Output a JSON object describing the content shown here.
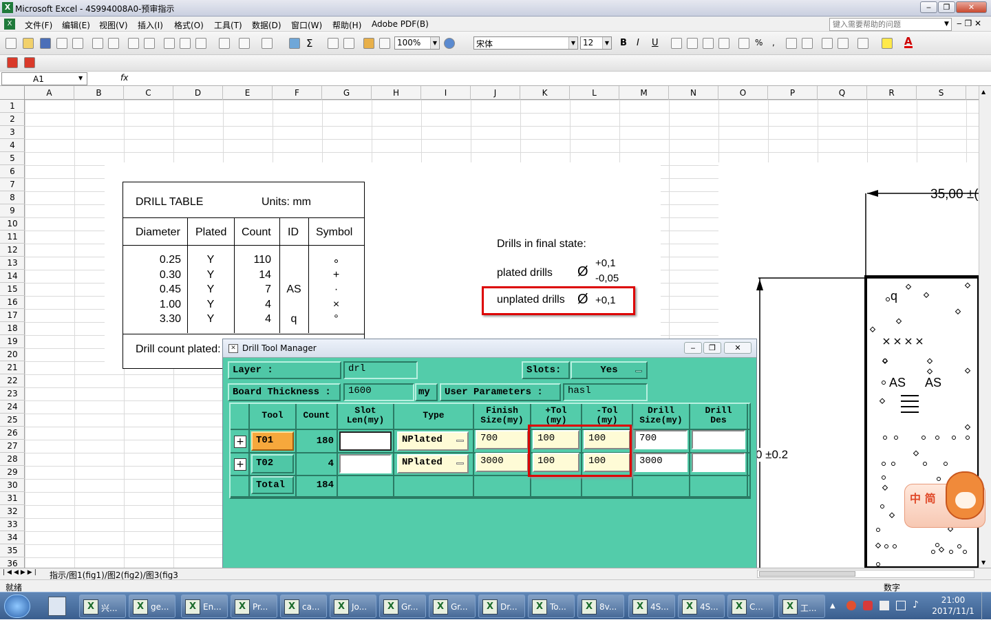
{
  "title": "Microsoft Excel - 4S994008A0-预审指示",
  "menu": [
    "文件(F)",
    "编辑(E)",
    "视图(V)",
    "插入(I)",
    "格式(O)",
    "工具(T)",
    "数据(D)",
    "窗口(W)",
    "帮助(H)",
    "Adobe PDF(B)"
  ],
  "help_placeholder": "键入需要帮助的问题",
  "toolbar": {
    "zoom": "100%",
    "font": "宋体",
    "size": "12"
  },
  "namebox": "A1",
  "fx": "fx",
  "columns": [
    "A",
    "B",
    "C",
    "D",
    "E",
    "F",
    "G",
    "H",
    "I",
    "J",
    "K",
    "L",
    "M",
    "N",
    "O",
    "P",
    "Q",
    "R",
    "S"
  ],
  "rows": [
    "1",
    "2",
    "3",
    "4",
    "5",
    "6",
    "7",
    "8",
    "9",
    "10",
    "11",
    "12",
    "13",
    "14",
    "15",
    "16",
    "17",
    "18",
    "19",
    "20",
    "21",
    "22",
    "23",
    "24",
    "25",
    "26",
    "27",
    "28",
    "29",
    "30",
    "31",
    "32",
    "33",
    "34",
    "35",
    "36"
  ],
  "drill_table": {
    "title": "DRILL TABLE",
    "units": "Units: mm",
    "headers": [
      "Diameter",
      "Plated",
      "Count",
      "ID",
      "Symbol"
    ],
    "rows": [
      {
        "d": "0.25",
        "p": "Y",
        "c": "110",
        "id": "",
        "s": "∘"
      },
      {
        "d": "0.30",
        "p": "Y",
        "c": "14",
        "id": "",
        "s": "+"
      },
      {
        "d": "0.45",
        "p": "Y",
        "c": "7",
        "id": "AS",
        "s": "·"
      },
      {
        "d": "1.00",
        "p": "Y",
        "c": "4",
        "id": "",
        "s": "×"
      },
      {
        "d": "3.30",
        "p": "Y",
        "c": "4",
        "id": "q",
        "s": "°"
      }
    ],
    "footer": "Drill count plated:"
  },
  "notes": {
    "heading": "Drills in final state:",
    "plated": "plated drills",
    "plated_plus": "+0,1",
    "plated_minus": "-0,05",
    "unplated": "unplated drills",
    "unplated_plus": "+0,1",
    "dia": "Ø"
  },
  "drawing": {
    "dim_top": "35,00 ±(",
    "dim_side": "0 ±0.2",
    "q": "q",
    "as": "AS"
  },
  "dtm": {
    "title": "Drill Tool Manager",
    "layer_label": "Layer         :",
    "layer_value": "drl",
    "slots_label": "Slots:",
    "slots_value": "Yes",
    "thickness_label": "Board Thickness :",
    "thickness_value": "1600",
    "thickness_unit": "my",
    "userparam_label": "User Parameters :",
    "userparam_value": "hasl",
    "headers": [
      "Tool",
      "Count",
      "Slot\nLen(my)",
      "Type",
      "Finish\nSize(my)",
      "+Tol\n(my)",
      "-Tol\n(my)",
      "Drill\nSize(my)",
      "Drill\nDes"
    ],
    "rows": [
      {
        "tool": "T01",
        "count": "180",
        "slot": "",
        "type": "NPlated",
        "finish": "700",
        "ptol": "100",
        "ntol": "100",
        "drill": "700",
        "des": ""
      },
      {
        "tool": "T02",
        "count": "4",
        "slot": "",
        "type": "NPlated",
        "finish": "3000",
        "ptol": "100",
        "ntol": "100",
        "drill": "3000",
        "des": ""
      }
    ],
    "total_label": "Total",
    "total_value": "184"
  },
  "sheet_tabs": "指示/图1(fig1)/图2(fig2)/图3(fig3",
  "status": {
    "left": "就绪",
    "right": "数字"
  },
  "taskbar": [
    "兴...",
    "ge...",
    "En...",
    "Pr...",
    "ca...",
    "Jo...",
    "Gr...",
    "Gr...",
    "Dr...",
    "To...",
    "8v...",
    "4S...",
    "4S...",
    "C...",
    "工..."
  ],
  "clock": {
    "time": "21:00",
    "date": "2017/11/1"
  },
  "ime": "中 简"
}
